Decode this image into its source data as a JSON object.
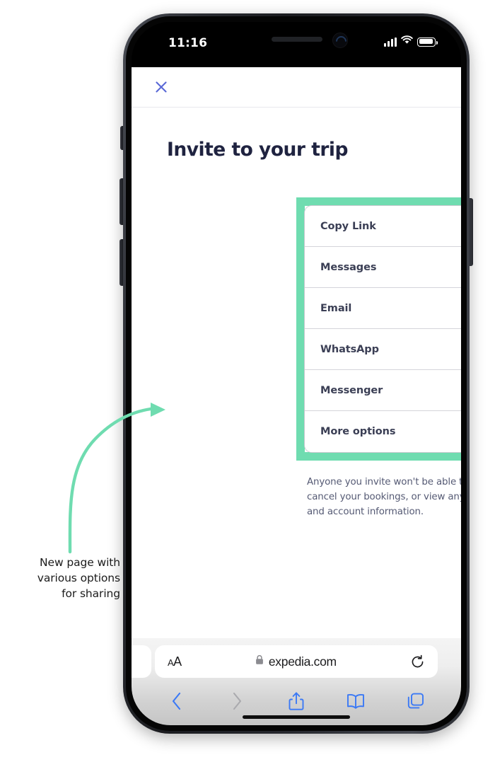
{
  "annotation": {
    "caption": "New page with\nvarious options\nfor sharing",
    "arrow_color": "#6fdcb0",
    "highlight_color": "#6fdcb0"
  },
  "device": {
    "status_bar": {
      "time": "11:16",
      "signal_icon": "cellular-signal-icon",
      "wifi_icon": "wifi-icon",
      "battery_icon": "battery-icon"
    }
  },
  "page": {
    "close_icon": "close-icon",
    "close_color": "#5968d6",
    "title": "Invite to your trip",
    "disclaimer": "Anyone you invite won't be able to manage or cancel your bookings, or view any of your personal and account information.",
    "share_options": [
      {
        "label": "Copy Link",
        "icon": "copy-icon"
      },
      {
        "label": "Messages",
        "icon": "messages-app-icon"
      },
      {
        "label": "Email",
        "icon": "envelope-icon"
      },
      {
        "label": "WhatsApp",
        "icon": "whatsapp-icon"
      },
      {
        "label": "Messenger",
        "icon": "messenger-icon"
      },
      {
        "label": "More options",
        "icon": "more-options-icon"
      }
    ]
  },
  "browser": {
    "text_size_label_small": "A",
    "text_size_label_big": "A",
    "lock_icon": "lock-icon",
    "url": "expedia.com",
    "reload_icon": "reload-icon",
    "toolbar": [
      {
        "name": "back-button",
        "icon": "chevron-left-icon",
        "enabled": true
      },
      {
        "name": "forward-button",
        "icon": "chevron-right-icon",
        "enabled": false
      },
      {
        "name": "share-button",
        "icon": "share-icon",
        "enabled": true
      },
      {
        "name": "bookmarks-button",
        "icon": "book-icon",
        "enabled": true
      },
      {
        "name": "tabs-button",
        "icon": "tabs-icon",
        "enabled": true
      }
    ]
  }
}
